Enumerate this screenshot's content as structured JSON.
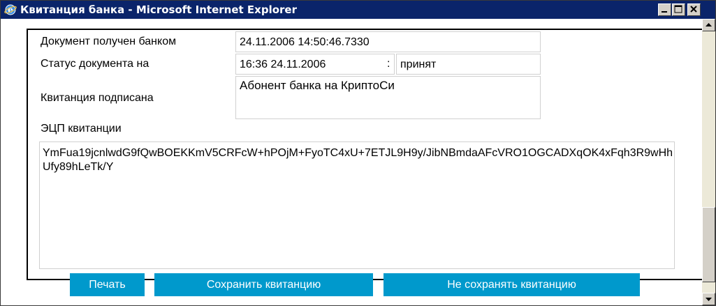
{
  "window": {
    "title": "Квитанция банка - Microsoft Internet Explorer",
    "title_icon": "ie-icon"
  },
  "receipt": {
    "received_label": "Документ получен банком",
    "received_value": "24.11.2006 14:50:46.7330",
    "status_label": "Статус документа на",
    "status_time": "16:36 24.11.2006",
    "status_sep": ":",
    "status_value": "принят",
    "signed_label": "Квитанция подписана",
    "signed_value": "Абонент банка на КриптоСи",
    "signature_label": "ЭЦП квитанции",
    "signature_value": "YmFua19jcnlwdG9fQwBOEKKmV5CRFcW+hPOjM+FyoTC4xU+7ETJL9H9y/JibNBmdaAFcVRO1OGCADXqOK4xFqh3R9wHhUfy89hLeTk/Y"
  },
  "buttons": {
    "print": "Печать",
    "save": "Сохранить квитанцию",
    "dont_save": "Не сохранять квитанцию"
  }
}
